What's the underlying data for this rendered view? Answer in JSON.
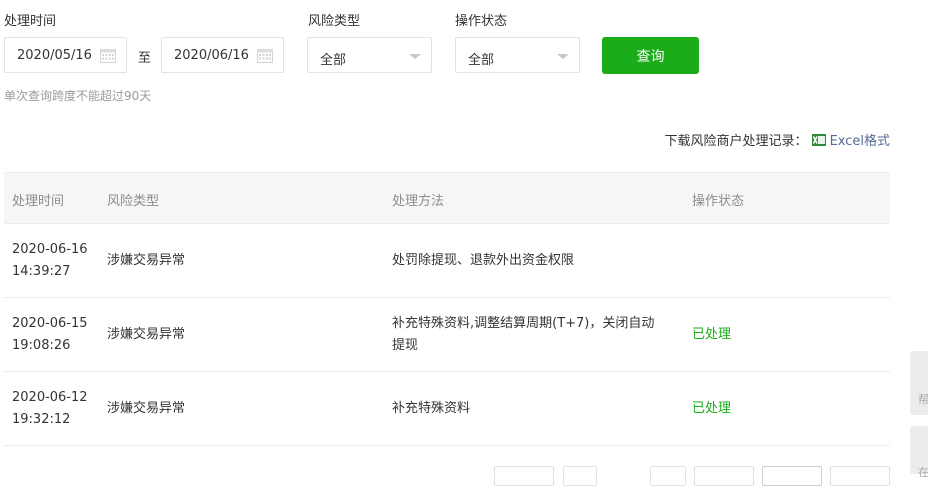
{
  "filters": {
    "time_label": "处理时间",
    "start_date": "2020/05/16",
    "to_label": "至",
    "end_date": "2020/06/16",
    "risk_label": "风险类型",
    "risk_value": "全部",
    "status_label": "操作状态",
    "status_value": "全部",
    "query_button": "查询",
    "hint": "单次查询跨度不能超过90天"
  },
  "download": {
    "prefix": "下载风险商户处理记录：",
    "link": "Excel格式"
  },
  "table": {
    "headers": [
      "处理时间",
      "风险类型",
      "处理方法",
      "操作状态"
    ],
    "rows": [
      {
        "time": "2020-06-16 14:39:27",
        "type": "涉嫌交易异常",
        "method": "处罚除提现、退款外出资金权限",
        "status": ""
      },
      {
        "time": "2020-06-15 19:08:26",
        "type": "涉嫌交易异常",
        "method": "补充特殊资料,调整结算周期(T+7)，关闭自动提现",
        "status": "已处理"
      },
      {
        "time": "2020-06-12 19:32:12",
        "type": "涉嫌交易异常",
        "method": "补充特殊资料",
        "status": "已处理"
      }
    ]
  },
  "side_tabs": [
    "帮",
    "在"
  ],
  "colors": {
    "accent": "#1aad19",
    "link": "#576b95",
    "header_bg": "#f6f6f6"
  }
}
